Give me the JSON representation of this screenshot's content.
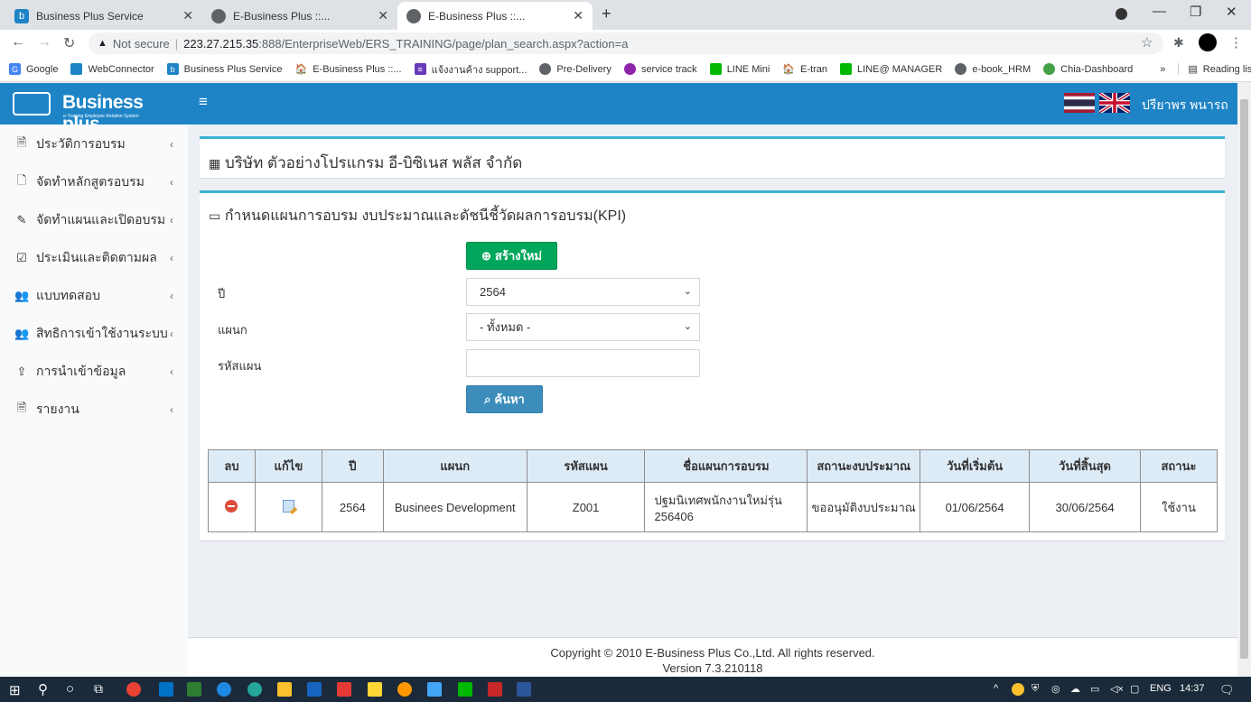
{
  "browser": {
    "tabs": [
      {
        "title": "Business Plus Service"
      },
      {
        "title": "E-Business Plus ::..."
      },
      {
        "title": "E-Business Plus ::..."
      }
    ],
    "new_tab": "+",
    "url_not_secure": "Not secure",
    "url_host": "223.27.215.35",
    "url_path": ":888/EnterpriseWeb/ERS_TRAINING/page/plan_search.aspx?action=a",
    "bookmarks": [
      "Google",
      "WebConnector",
      "Business Plus Service",
      "E-Business Plus ::...",
      "แจ้งงานค้าง support...",
      "Pre-Delivery",
      "service track",
      "LINE Mini",
      "E-tran",
      "LINE@ MANAGER",
      "e-book_HRM",
      "Chia-Dashboard"
    ],
    "bookmarks_more": "»",
    "reading_list": "Reading list"
  },
  "app": {
    "logo_text": "Business plus",
    "logo_sub": "e-Training Employee Relation System",
    "user_name": "ปรียาพร พนารถ",
    "accent": "#1e84c6"
  },
  "sidebar": {
    "items": [
      {
        "label": "ประวัติการอบรม",
        "icon": "file-icon"
      },
      {
        "label": "จัดทำหลักสูตรอบรม",
        "icon": "course-icon"
      },
      {
        "label": "จัดทำแผนและเปิดอบรม",
        "icon": "edit-icon"
      },
      {
        "label": "ประเมินและติดตามผล",
        "icon": "check-icon"
      },
      {
        "label": "แบบทดสอบ",
        "icon": "users-icon"
      },
      {
        "label": "สิทธิการเข้าใช้งานระบบ",
        "icon": "users-icon"
      },
      {
        "label": "การนำเข้าข้อมูล",
        "icon": "upload-icon"
      },
      {
        "label": "รายงาน",
        "icon": "pdf-icon"
      }
    ]
  },
  "company": {
    "title": "บริษัท ตัวอย่างโปรแกรม อี-บิซิเนส พลัส จำกัด"
  },
  "form": {
    "title": "กำหนดแผนการอบรม งบประมาณและดัชนีชี้วัดผลการอบรม(KPI)",
    "new_button": "สร้างใหม่",
    "year_label": "ปี",
    "year_value": "2564",
    "dept_label": "แผนก",
    "dept_value": "- ทั้งหมด -",
    "code_label": "รหัสแผน",
    "code_value": "",
    "search_button": "ค้นหา"
  },
  "table": {
    "headers": [
      "ลบ",
      "แก้ไข",
      "ปี",
      "แผนก",
      "รหัสแผน",
      "ชื่อแผนการอบรม",
      "สถานะงบประมาณ",
      "วันที่เริ่มต้น",
      "วันที่สิ้นสุด",
      "สถานะ"
    ],
    "rows": [
      {
        "year": "2564",
        "dept": "Businees Development",
        "code": "Z001",
        "name": "ปฐมนิเทศพนักงานใหม่รุ่น 256406",
        "budget_status": "ขออนุมัติงบประมาณ",
        "start": "01/06/2564",
        "end": "30/06/2564",
        "status": "ใช้งาน"
      }
    ]
  },
  "footer": {
    "copyright": "Copyright © 2010 E-Business Plus Co.,Ltd. All rights reserved.",
    "version": "Version 7.3.210118"
  },
  "taskbar": {
    "lang": "ENG",
    "time": "14:37"
  }
}
